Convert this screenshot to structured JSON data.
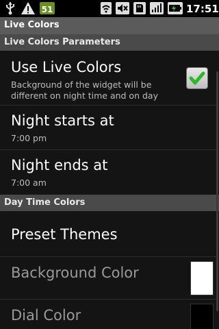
{
  "statusbar": {
    "battery_badge": "51",
    "time": "17:51",
    "icons": [
      "usb-icon",
      "warning-icon",
      "battery-badge",
      "wifi-icon",
      "mute-icon",
      "sd-card-icon",
      "signal-icon",
      "battery-icon"
    ]
  },
  "titlebar": {
    "title": "Live Colors"
  },
  "sections": [
    {
      "label": "Live Colors Parameters"
    },
    {
      "label": "Day Time Colors"
    }
  ],
  "items": {
    "use_live_colors": {
      "title": "Use Live Colors",
      "summary_line1": "Background of the widget will be",
      "summary_line2": "different on night time and on day",
      "checked": true,
      "check_color": "#2fb82a"
    },
    "night_starts": {
      "title": "Night starts at",
      "summary": "7:00 pm"
    },
    "night_ends": {
      "title": "Night ends at",
      "summary": "7:00 am"
    },
    "preset_themes": {
      "title": "Preset Themes"
    },
    "background_color": {
      "title": "Background Color",
      "swatch": "#ffffff"
    },
    "dial_color": {
      "title": "Dial Color",
      "swatch": "#000000"
    }
  }
}
